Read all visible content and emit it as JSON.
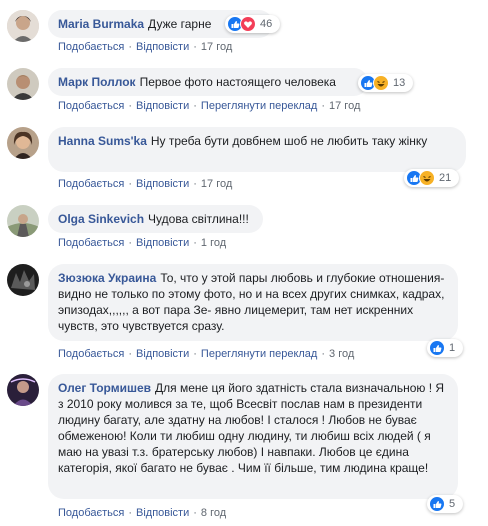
{
  "labels": {
    "like": "Подобається",
    "reply": "Відповісти",
    "see_translation": "Переглянути переклад"
  },
  "comments": [
    {
      "author": "Maria Burmaka",
      "text": "Дуже гарне",
      "time": "17 год",
      "reaction_count": "46",
      "reactions": [
        "like-icon",
        "love-icon"
      ]
    },
    {
      "author": "Марк Поллок",
      "text": "Первое фото настоящего человека",
      "time": "17 год",
      "reaction_count": "13",
      "reactions": [
        "like-icon",
        "haha-icon"
      ]
    },
    {
      "author": "Hanna Sums'ka",
      "text": "Ну треба бути довбнем шоб не любить таку жінку",
      "time": "17 год",
      "reaction_count": "21",
      "reactions": [
        "like-icon",
        "haha-icon"
      ]
    },
    {
      "author": "Olga Sinkevich",
      "text": "Чудова світлина!!!",
      "time": "1 год",
      "reaction_count": "",
      "reactions": []
    },
    {
      "author": "Зюзюка Украина",
      "text": "То, что у этой пары любовь и глубокие отношения- видно не только по этому фото, но и на всех других снимках, кадрах, эпизодах,,,,,, а вот пара Зе- явно лицемерит, там нет искренних чувств, это чувствуется сразу.",
      "time": "3 год",
      "reaction_count": "1",
      "reactions": [
        "like-icon"
      ]
    },
    {
      "author": "Олег Тормишев",
      "text": "Для мене ця його здатність стала визначальною ! Я з 2010 року молився за те, щоб Всесвіт послав нам в президенти людину багату, але здатну на любов! І сталося ! Любов не буває обмеженою! Коли ти любиш одну людину, ти любиш всіх людей ( я маю на увазі т.з. братерську любов) І навпаки. Любов це єдина категорія, якої багато не буває . Чим її більше, тим людина краще!",
      "time": "8 год",
      "reaction_count": "5",
      "reactions": [
        "like-icon"
      ]
    }
  ],
  "colors": {
    "link": "#385898",
    "bubble": "#f2f3f5",
    "like": "#1877f2",
    "love": "#f33e58",
    "haha": "#f7b125"
  }
}
